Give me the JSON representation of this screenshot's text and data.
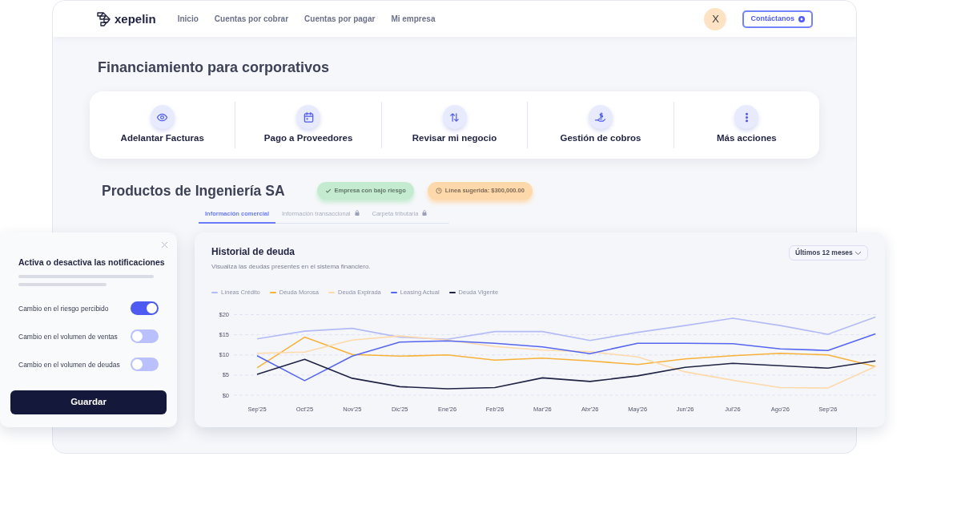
{
  "nav": {
    "logo_text": "xepelin",
    "links": [
      {
        "label": "Inicio"
      },
      {
        "label": "Cuentas por cobrar"
      },
      {
        "label": "Cuentas por pagar"
      },
      {
        "label": "Mi empresa"
      }
    ],
    "avatar_initial": "X",
    "contact_button": "Contáctanos"
  },
  "page_title": "Financiamiento para corporativos",
  "actions": [
    {
      "kind": "eye",
      "label": "Adelantar Facturas"
    },
    {
      "kind": "calendar",
      "label": "Pago a Proveedores"
    },
    {
      "kind": "arrows",
      "label": "Revisar mi negocio"
    },
    {
      "kind": "hand",
      "label": "Gestión de cobros"
    },
    {
      "kind": "dots",
      "label": "Más acciones"
    }
  ],
  "company": {
    "name": "Productos de Ingeniería SA",
    "badges": [
      {
        "kind": "check",
        "text": "Empresa con bajo riesgo",
        "color": "#c4ebd0"
      },
      {
        "kind": "clock",
        "text": "Línea sugerida: $300,000.00",
        "color": "#fdd8ab"
      }
    ]
  },
  "tabs": [
    {
      "label": "Información comercial",
      "selected": true,
      "locked": false
    },
    {
      "label": "Información transaccional",
      "selected": false,
      "locked": true
    },
    {
      "label": "Carpeta tributaria",
      "selected": false,
      "locked": true
    }
  ],
  "notifications": {
    "title": "Activa o desactiva las notificaciones",
    "items": [
      {
        "label": "Cambio en el riesgo percibido",
        "on": true
      },
      {
        "label": "Cambio en el volumen de ventas",
        "on": false
      },
      {
        "label": "Cambio en el volumen de deudas",
        "on": false
      }
    ],
    "save_button": "Guardar"
  },
  "debt_history": {
    "title": "Historial de deuda",
    "subtitle": "Visualiza las deudas presentes en el sistema financiero.",
    "period": "Últimos 12 meses",
    "chart_data": {
      "type": "line",
      "grid": true,
      "categories": [
        "Sep'25",
        "Oct'25",
        "Nov'25",
        "Dic'25",
        "Ene'26",
        "Feb'26",
        "Mar'26",
        "Abr'26",
        "May'26",
        "Jun'26",
        "Jul'26",
        "Ago'26",
        "Sep'26",
        null
      ],
      "ylim": [
        0,
        20
      ],
      "yticks": [
        {
          "value": 20,
          "label": "$20"
        },
        {
          "value": 15,
          "label": "$15"
        },
        {
          "value": 10,
          "label": "$10"
        },
        {
          "value": 5,
          "label": "$5"
        },
        {
          "value": 0,
          "label": "$0"
        }
      ],
      "series": [
        {
          "name": "Líneas Crédito",
          "color": "#b3bbf7",
          "values": [
            14.0,
            15.9,
            16.6,
            14.4,
            13.9,
            15.8,
            15.8,
            13.6,
            15.6,
            17.3,
            19.1,
            17.3,
            15.1,
            19.4
          ]
        },
        {
          "name": "Deuda Morosa",
          "color": "#f7b23b",
          "values": [
            6.8,
            14.4,
            10.1,
            9.7,
            10.0,
            8.7,
            9.2,
            8.5,
            7.6,
            9.0,
            9.8,
            10.4,
            10.0,
            7.1
          ]
        },
        {
          "name": "Deuda Expirada",
          "color": "#fdd9ab",
          "values": [
            10.4,
            10.7,
            13.7,
            14.7,
            13.7,
            12.1,
            11.2,
            10.8,
            9.5,
            5.8,
            3.7,
            1.9,
            1.8,
            7.1
          ]
        },
        {
          "name": "Leasing Actual",
          "color": "#5566f0",
          "values": [
            9.8,
            3.6,
            9.7,
            13.2,
            13.5,
            12.9,
            12.0,
            10.3,
            12.9,
            12.9,
            12.8,
            11.5,
            11.1,
            15.2
          ]
        },
        {
          "name": "Deuda Vigente",
          "color": "#1f2344",
          "values": [
            5.2,
            8.9,
            4.2,
            2.1,
            1.6,
            1.9,
            4.3,
            3.4,
            4.8,
            6.9,
            7.9,
            7.3,
            6.7,
            8.5
          ]
        }
      ]
    }
  }
}
